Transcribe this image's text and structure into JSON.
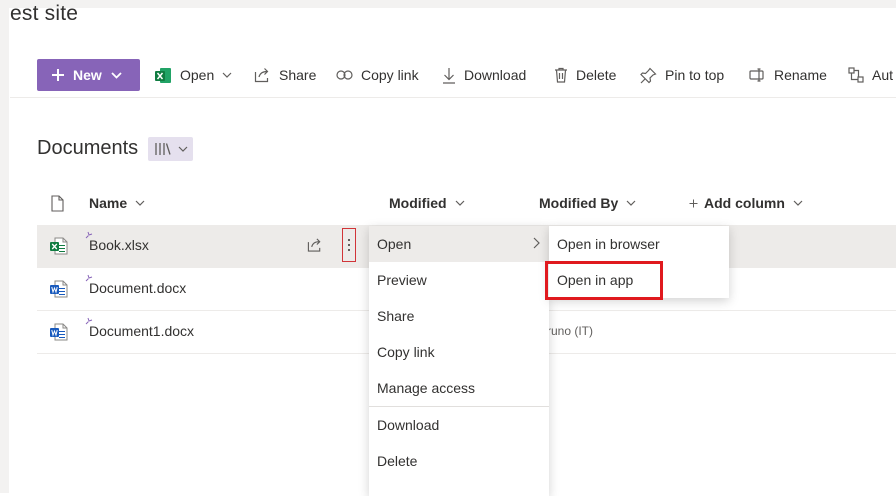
{
  "site": {
    "title": "est site"
  },
  "commandbar": {
    "new_label": "New",
    "open_label": "Open",
    "share_label": "Share",
    "copylink_label": "Copy link",
    "download_label": "Download",
    "delete_label": "Delete",
    "pin_label": "Pin to top",
    "rename_label": "Rename",
    "automate_label": "Aut"
  },
  "library": {
    "title": "Documents"
  },
  "columns": {
    "name": "Name",
    "modified": "Modified",
    "modified_by": "Modified By",
    "add_column": "Add column"
  },
  "files": [
    {
      "name": "Book.xlsx",
      "type": "excel",
      "modified_by": ""
    },
    {
      "name": "Document.docx",
      "type": "word",
      "modified_by": ""
    },
    {
      "name": "Document1.docx",
      "type": "word",
      "modified_by": "runo (IT)"
    }
  ],
  "context_menu": {
    "items": [
      "Open",
      "Preview",
      "Share",
      "Copy link",
      "Manage access",
      "Download",
      "Delete"
    ]
  },
  "submenu": {
    "items": [
      "Open in browser",
      "Open in app"
    ]
  },
  "colors": {
    "brand": "#8764b8",
    "selected_row": "#edebe9",
    "highlight": "#e0191e",
    "excel": "#107c41",
    "word": "#185abd"
  }
}
